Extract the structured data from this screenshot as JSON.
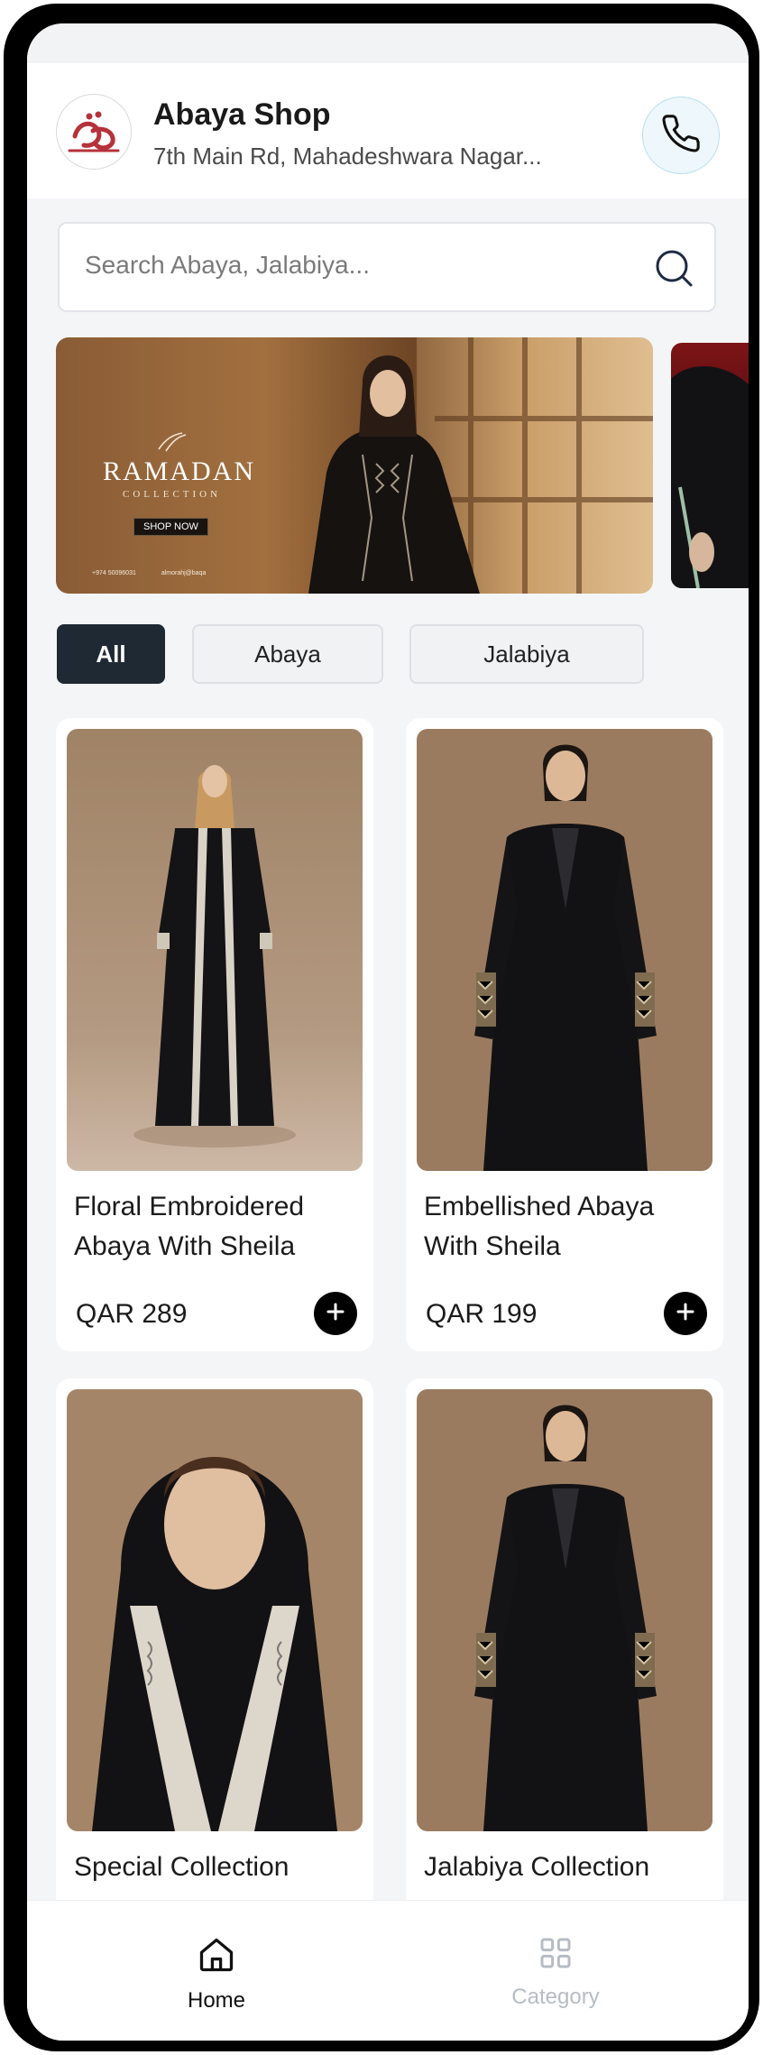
{
  "header": {
    "shop_name": "Abaya Shop",
    "address": "7th Main Rd, Mahadeshwara Nagar..."
  },
  "search": {
    "placeholder": "Search Abaya, Jalabiya..."
  },
  "banner": {
    "title": "RAMADAN",
    "subtitle": "COLLECTION",
    "cta": "SHOP NOW",
    "phone": "+974 50096031",
    "email": "almorahj@baqa"
  },
  "filters": [
    {
      "label": "All",
      "selected": true
    },
    {
      "label": "Abaya",
      "selected": false
    },
    {
      "label": "Jalabiya",
      "selected": false
    }
  ],
  "products": [
    {
      "name": "Floral Embroidered Abaya With Sheila",
      "price": "QAR 289"
    },
    {
      "name": "Embellished Abaya With Sheila",
      "price": "QAR 199"
    },
    {
      "name": "Special Collection",
      "price": ""
    },
    {
      "name": "Jalabiya Collection",
      "price": ""
    }
  ],
  "bottom_nav": [
    {
      "label": "Home",
      "icon": "home-icon",
      "active": true
    },
    {
      "label": "Category",
      "icon": "grid-icon",
      "active": false
    }
  ],
  "colors": {
    "accent_dark": "#1f2933",
    "logo_red": "#b5323a",
    "inactive": "#b7bcc3",
    "call_bg": "#eef7fb"
  }
}
